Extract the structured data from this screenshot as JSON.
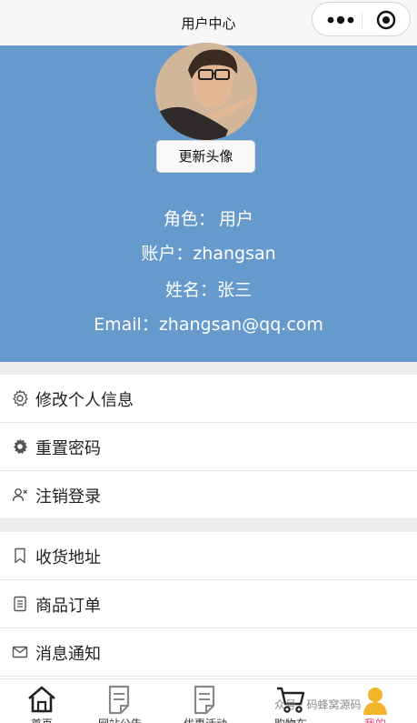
{
  "navbar": {
    "title": "用户中心"
  },
  "profile": {
    "avatar_button": "更新头像",
    "role_label": "角色：",
    "role_value": "用户",
    "account_label": "账户：",
    "account_value": "zhangsan",
    "name_label": "姓名：",
    "name_value": "张三",
    "email_label": "Email：",
    "email_value": "zhangsan@qq.com"
  },
  "menu_group_1": [
    {
      "label": "修改个人信息",
      "icon": "gear-outline-icon"
    },
    {
      "label": "重置密码",
      "icon": "gear-filled-icon"
    },
    {
      "label": "注销登录",
      "icon": "user-remove-icon"
    }
  ],
  "menu_group_2": [
    {
      "label": "收货地址",
      "icon": "bookmark-icon"
    },
    {
      "label": "商品订单",
      "icon": "document-list-icon"
    },
    {
      "label": "消息通知",
      "icon": "mail-icon"
    }
  ],
  "tabbar": {
    "tabs": [
      {
        "label": "首页",
        "icon": "home-icon"
      },
      {
        "label": "网站公告",
        "icon": "notice-icon"
      },
      {
        "label": "优惠活动",
        "icon": "promotion-icon"
      },
      {
        "label": "购物车",
        "icon": "cart-icon"
      },
      {
        "label": "我的",
        "icon": "user-icon"
      }
    ],
    "active_index": 4
  },
  "watermark": "众号 · 码蜂窝源码",
  "colors": {
    "profile_bg": "#6699cc",
    "divider_bg": "#ededed",
    "active_tab": "#e0457b"
  }
}
